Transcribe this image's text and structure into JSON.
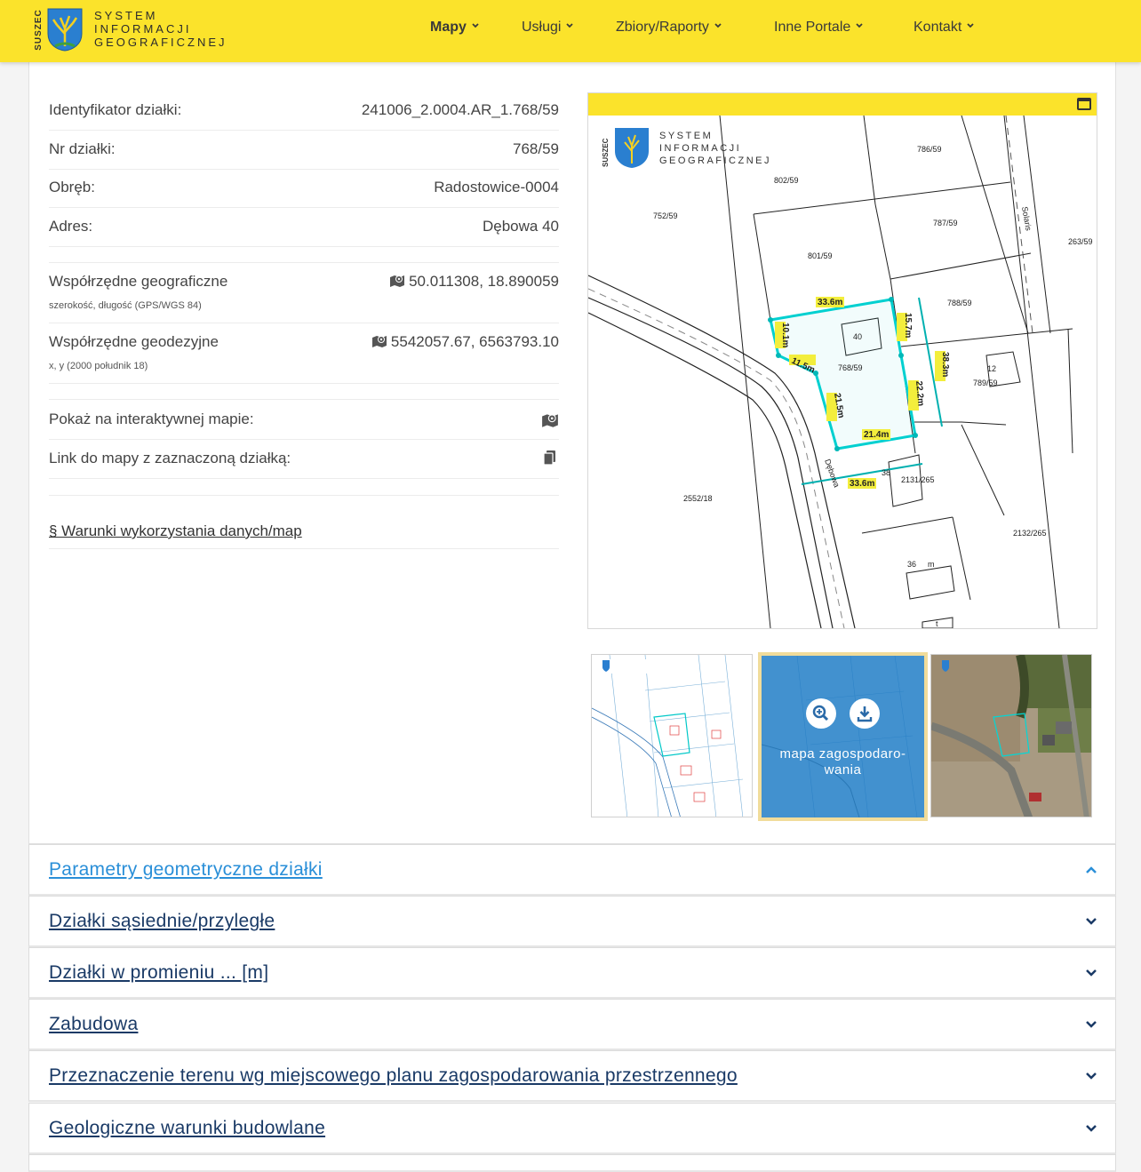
{
  "brand": {
    "vertical": "SUSZEC",
    "line1": "SYSTEM",
    "line2": "INFORMACJI",
    "line3": "GEOGRAFICZNEJ"
  },
  "nav": [
    {
      "label": "Mapy",
      "active": true
    },
    {
      "label": "Usługi",
      "active": false
    },
    {
      "label": "Zbiory/Raporty",
      "active": false
    },
    {
      "label": "Inne Portale",
      "active": false
    },
    {
      "label": "Kontakt",
      "active": false
    }
  ],
  "parcel": {
    "id_label": "Identyfikator działki:",
    "id_value": "241006_2.0004.AR_1.768/59",
    "nr_label": "Nr działki:",
    "nr_value": "768/59",
    "obreb_label": "Obręb:",
    "obreb_value": "Radostowice-0004",
    "adres_label": "Adres:",
    "adres_value": "Dębowa 40",
    "geo_label": "Współrzędne geograficzne",
    "geo_sub": "szerokość, długość (GPS/WGS 84)",
    "geo_value": "50.011308, 18.890059",
    "geod_label": "Współrzędne geodezyjne",
    "geod_sub": "x, y (2000 południk 18)",
    "geod_value": "5542057.67, 6563793.10",
    "map_label": "Pokaż na interaktywnej mapie:",
    "link_label": "Link do mapy z zaznaczoną działką:",
    "terms": "§ Warunki wykorzystania danych/map"
  },
  "map": {
    "logo_vertical": "SUSZEC",
    "logo_l1": "SYSTEM",
    "logo_l2": "INFORMACJI",
    "logo_l3": "GEOGRAFICZNEJ",
    "labels": {
      "p786": "786/59",
      "p802": "802/59",
      "p752": "752/59",
      "p787": "787/59",
      "p263": "263/59",
      "p801": "801/59",
      "p788": "788/59",
      "p768": "768/59",
      "p789": "789/59",
      "p2131": "2131/265",
      "p2552": "2552/18",
      "p2132": "2132/265",
      "street1": "Solaris",
      "street2": "Dębowa",
      "h40": "40",
      "h12": "12",
      "h38": "38",
      "h36": "36",
      "hm": "m",
      "ht": "t"
    },
    "dims": {
      "d1": "33.6m",
      "d2": "10.1m",
      "d3": "11.5m",
      "d4": "15.7m",
      "d5": "38.3m",
      "d6": "21.5m",
      "d7": "22.2m",
      "d8": "21.4m",
      "d9": "33.6m"
    },
    "accent_color": "#00c8c8"
  },
  "thumbnails": {
    "active_label": "mapa zagospodaro-wania",
    "active_label_l1": "mapa zagospodaro-",
    "active_label_l2": "wania"
  },
  "accordion": [
    {
      "title": "Parametry geometryczne działki",
      "open": true
    },
    {
      "title": "Działki sąsiednie/przyległe",
      "open": false
    },
    {
      "title": "Działki w promieniu ... [m]",
      "open": false
    },
    {
      "title": "Zabudowa",
      "open": false
    },
    {
      "title": "Przeznaczenie terenu wg miejscowego planu zagospodarowania przestrzennego",
      "open": false
    },
    {
      "title": "Geologiczne warunki budowlane",
      "open": false
    }
  ],
  "colors": {
    "brand_yellow": "#fbe32b",
    "link_blue": "#2a8fd8",
    "link_dark": "#1a3a66"
  }
}
